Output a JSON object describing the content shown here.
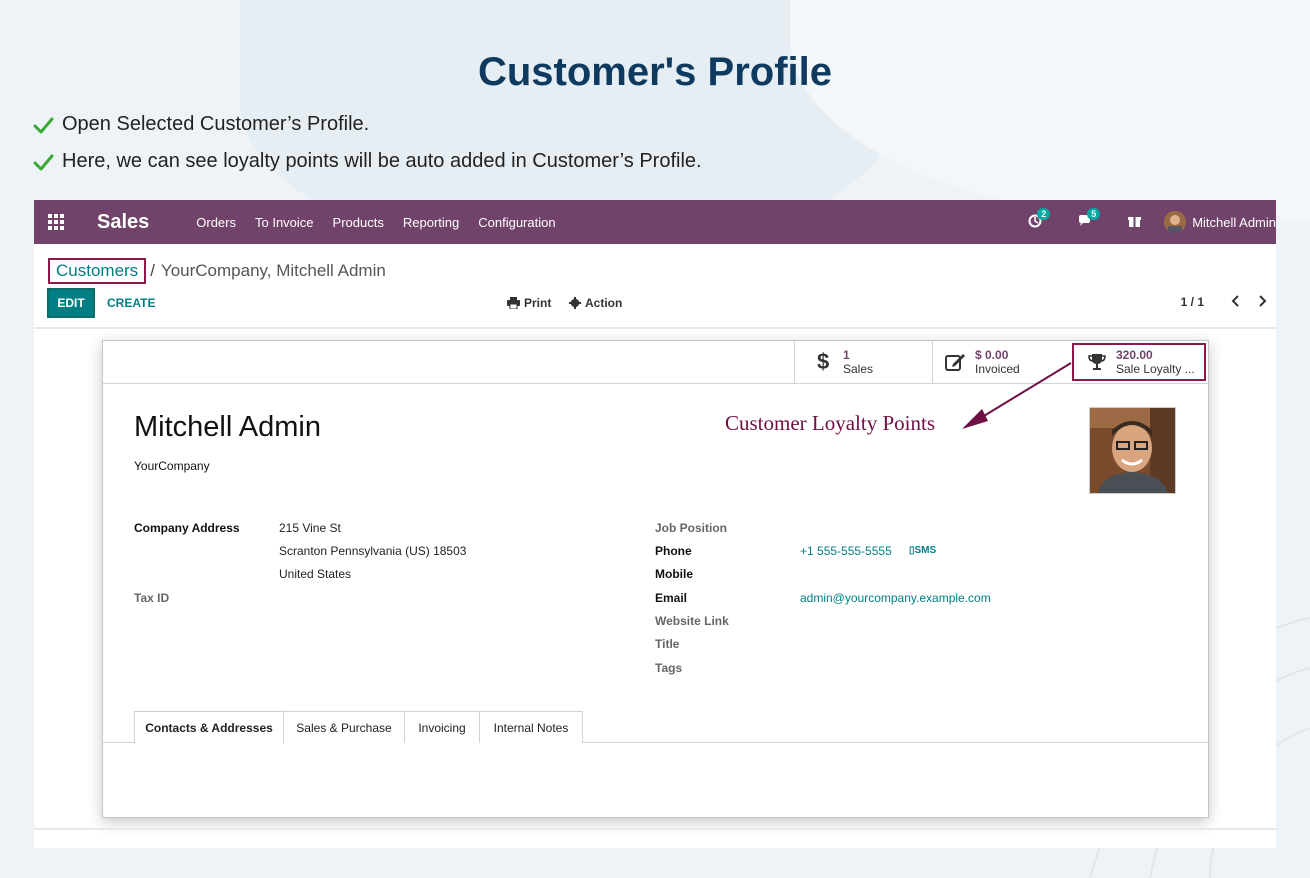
{
  "page": {
    "title": "Customer's Profile",
    "bullets": [
      "Open Selected Customer’s Profile.",
      "Here, we can see loyalty points will be auto added in Customer’s Profile."
    ]
  },
  "navbar": {
    "brand": "Sales",
    "menu": [
      "Orders",
      "To Invoice",
      "Products",
      "Reporting",
      "Configuration"
    ],
    "activity_count": "2",
    "messages_count": "5",
    "user": "Mitchell Admin",
    "bg_color": "#71436a"
  },
  "breadcrumb": {
    "parent": "Customers",
    "separator": "/",
    "current": "YourCompany, Mitchell Admin"
  },
  "toolbar": {
    "edit": "EDIT",
    "create": "CREATE",
    "print": "Print",
    "action": "Action",
    "pager": "1 / 1"
  },
  "stat_buttons": [
    {
      "value": "1",
      "label": "Sales",
      "icon": "dollar-icon"
    },
    {
      "value": "$ 0.00",
      "label": "Invoiced",
      "icon": "edit-icon"
    },
    {
      "value": "320.00",
      "label": "Sale Loyalty ...",
      "icon": "trophy-icon"
    }
  ],
  "customer": {
    "name": "Mitchell Admin",
    "company": "YourCompany"
  },
  "annotation": "Customer Loyalty Points",
  "fields": {
    "company_address_label": "Company Address",
    "address_line1": "215 Vine St",
    "address_line2": "Scranton  Pennsylvania (US)  18503",
    "address_line3": "United States",
    "tax_id_label": "Tax ID",
    "job_position_label": "Job Position",
    "phone_label": "Phone",
    "phone_value": "+1 555-555-5555",
    "sms_label": "SMS",
    "mobile_label": "Mobile",
    "email_label": "Email",
    "email_value": "admin@yourcompany.example.com",
    "website_label": "Website Link",
    "title_label": "Title",
    "tags_label": "Tags"
  },
  "tabs": [
    "Contacts & Addresses",
    "Sales & Purchase",
    "Invoicing",
    "Internal Notes"
  ],
  "colors": {
    "accent": "#017e84",
    "highlight_border": "#8b1a4b",
    "title": "#0e3a5f",
    "check": "#3aa935"
  }
}
